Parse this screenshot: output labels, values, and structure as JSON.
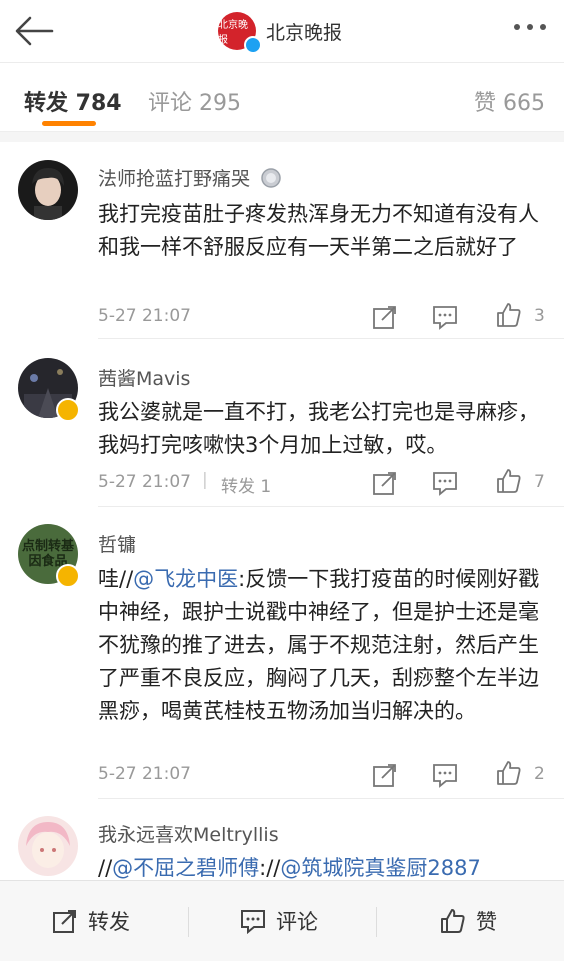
{
  "header": {
    "brand_logo_text": "北京晚报",
    "brand_name": "北京晚报"
  },
  "tabs": [
    {
      "label": "转发 784"
    },
    {
      "label": "评论 295"
    },
    {
      "label": "赞 665"
    }
  ],
  "comments": [
    {
      "name": "法师抢蓝打野痛哭",
      "text": "我打完疫苗肚子疼发热浑身无力不知道有没有人和我一样不舒服反应有一天半第二之后就好了",
      "time": "5-27 21:07",
      "likes": "3"
    },
    {
      "name": "茜酱Mavis",
      "text": "我公婆就是一直不打，我老公打完也是寻麻疹，我妈打完咳嗽快3个月加上过敏，哎。",
      "time": "5-27 21:07",
      "reposts": "转发 1",
      "likes": "7"
    },
    {
      "name": "哲镛",
      "text_prefix": "哇//",
      "mention": "@飞龙中医",
      "text_rest": ":反馈一下我打疫苗的时候刚好戳中神经，跟护士说戳中神经了，但是护士还是毫不犹豫的推了进去，属于不规范注射，然后产生了严重不良反应，胸闷了几天，刮痧整个左半边黑痧，喝黄芪桂枝五物汤加当归解决的。",
      "avatar_text": "点制转基因食品",
      "time": "5-27 21:07",
      "likes": "2"
    },
    {
      "name": "我永远喜欢Meltryllis",
      "text_prefix": "//",
      "mention1": "@不屈之碧师傅",
      "mid": "://",
      "mention2": "@筑城院真鉴厨2887"
    }
  ],
  "footer": {
    "repost": "转发",
    "comment": "评论",
    "like": "赞"
  },
  "colors": {
    "accent": "#ff8200",
    "link": "#3a6bb0",
    "verified_gold": "#f5b400",
    "verified_blue": "#1da1f2"
  }
}
